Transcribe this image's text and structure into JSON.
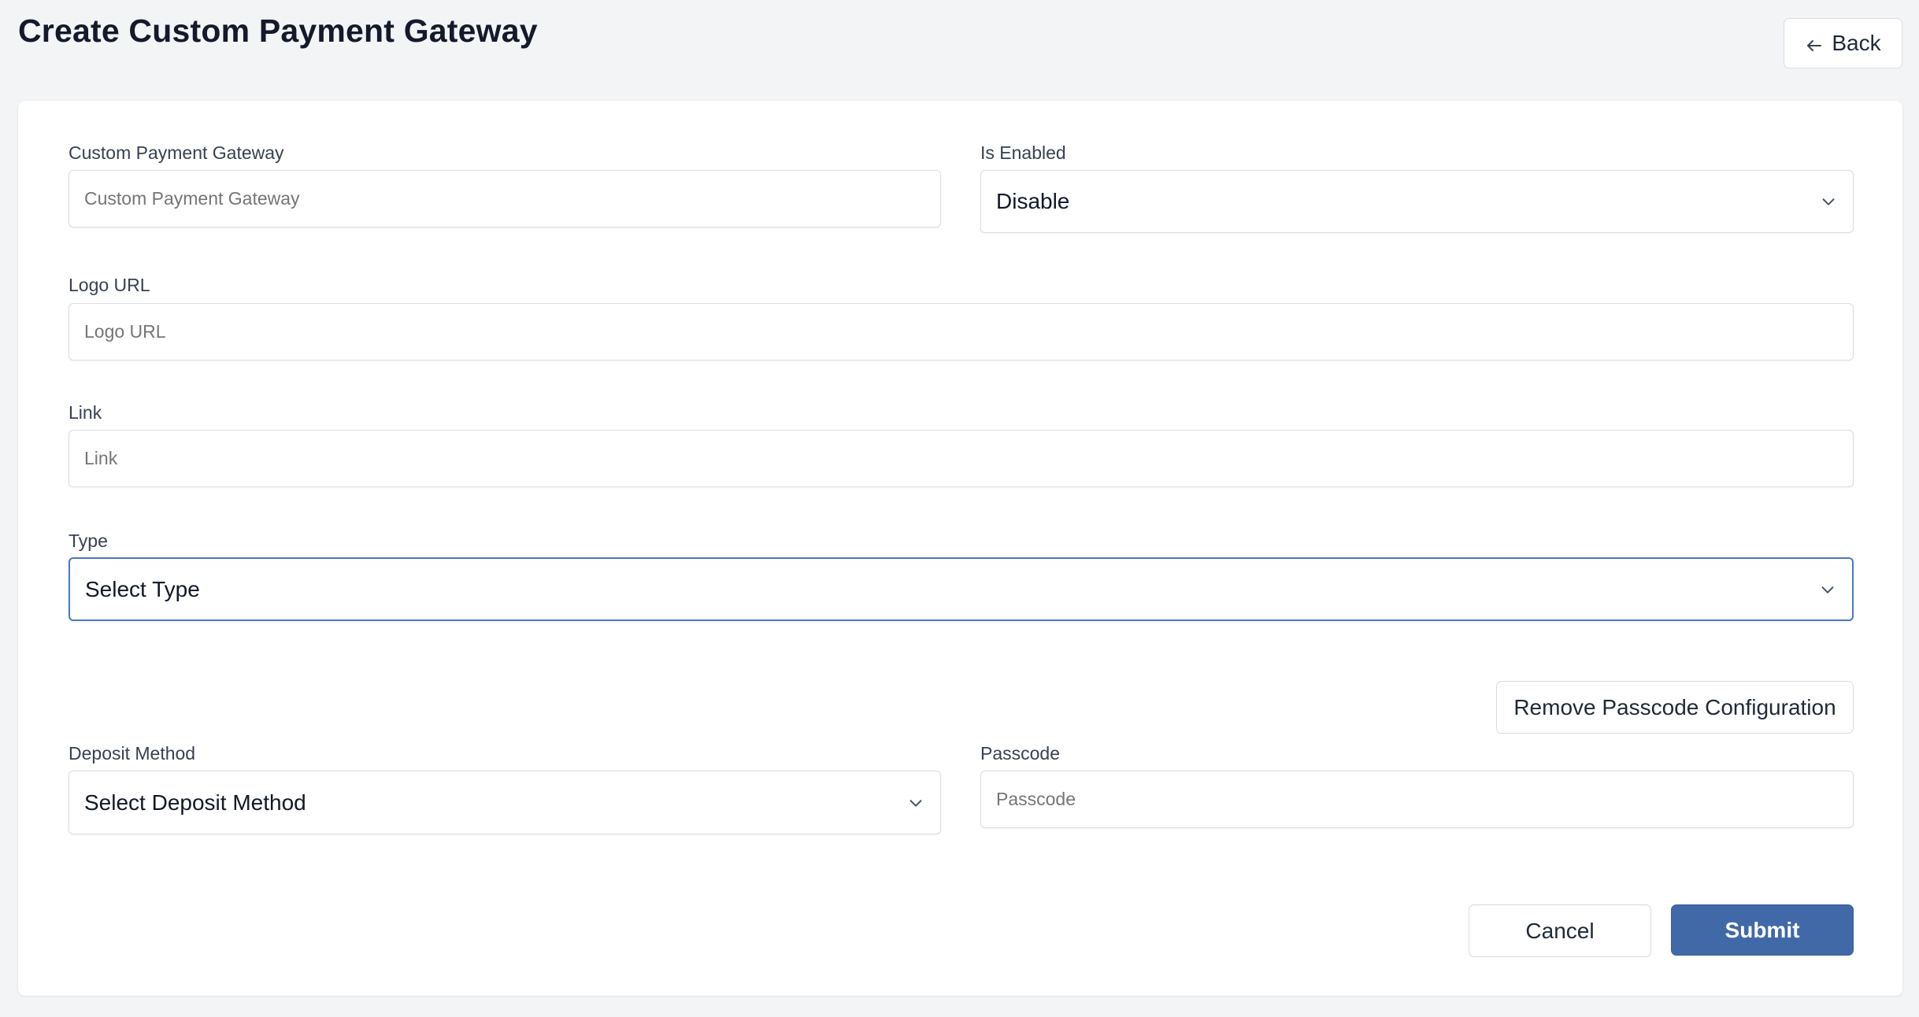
{
  "page": {
    "title": "Create Custom Payment Gateway",
    "back_label": "Back"
  },
  "form": {
    "gateway_name": {
      "label": "Custom Payment Gateway",
      "placeholder": "Custom Payment Gateway",
      "value": ""
    },
    "is_enabled": {
      "label": "Is Enabled",
      "value": "Disable"
    },
    "logo_url": {
      "label": "Logo URL",
      "placeholder": "Logo URL",
      "value": ""
    },
    "link": {
      "label": "Link",
      "placeholder": "Link",
      "value": ""
    },
    "type": {
      "label": "Type",
      "value": "Select Type"
    },
    "remove_passcode_label": "Remove Passcode Configuration",
    "deposit_method": {
      "label": "Deposit Method",
      "value": "Select Deposit Method"
    },
    "passcode": {
      "label": "Passcode",
      "placeholder": "Passcode",
      "value": ""
    },
    "cancel_label": "Cancel",
    "submit_label": "Submit"
  },
  "colors": {
    "primary": "#4169a8",
    "focus_border": "#4a78c2",
    "background": "#f3f4f6"
  },
  "icons": {
    "back": "arrow-left-icon",
    "dropdown": "chevron-down-icon"
  }
}
